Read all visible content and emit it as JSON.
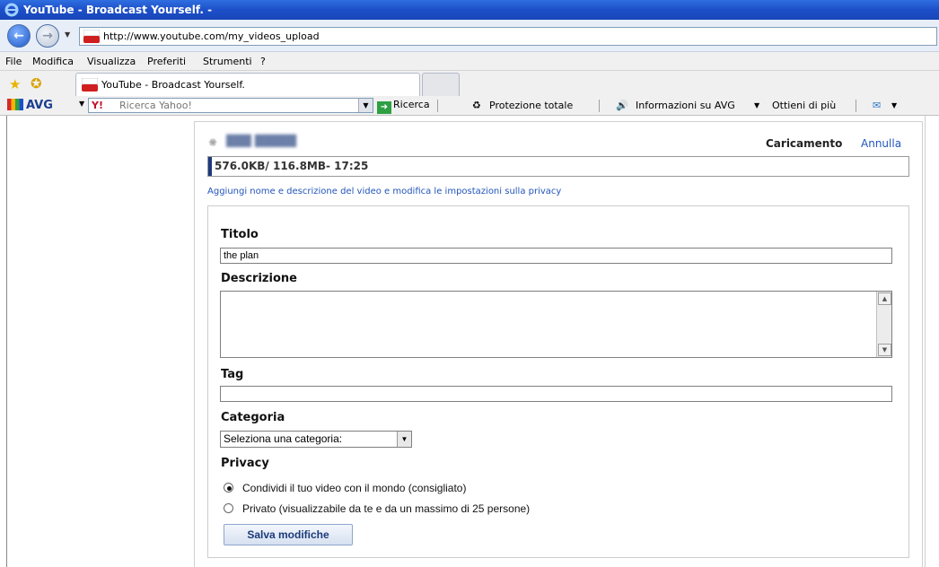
{
  "window": {
    "title": "YouTube - Broadcast Yourself. -"
  },
  "address_bar": {
    "url": "http://www.youtube.com/my_videos_upload"
  },
  "menu": [
    "File",
    "Modifica",
    "Visualizza",
    "Preferiti",
    "Strumenti",
    "?"
  ],
  "tabs": [
    {
      "label": "YouTube - Broadcast Yourself."
    }
  ],
  "avg_toolbar": {
    "logo": "AVG",
    "search_placeholder": "Ricerca Yahoo!",
    "search_button": "Ricerca",
    "protection": "Protezione totale",
    "info": "Informazioni su AVG",
    "more": "Ottieni di più"
  },
  "upload": {
    "status": "Caricamento",
    "cancel": "Annulla",
    "progress_text": "576.0KB/ 116.8MB- 17:25",
    "progress_fraction": 0.005,
    "details_link": "Aggiungi nome e descrizione del video e modifica le impostazioni sulla privacy"
  },
  "form": {
    "title_label": "Titolo",
    "title_value": "the plan",
    "description_label": "Descrizione",
    "description_value": "",
    "tag_label": "Tag",
    "tag_value": "",
    "category_label": "Categoria",
    "category_selected": "Seleziona una categoria:",
    "privacy_label": "Privacy",
    "privacy_options": [
      {
        "label": "Condividi il tuo video con il mondo (consigliato)",
        "checked": true
      },
      {
        "label": "Privato (visualizzabile da te e da un massimo di 25 persone)",
        "checked": false
      }
    ],
    "save_button": "Salva modifiche"
  }
}
